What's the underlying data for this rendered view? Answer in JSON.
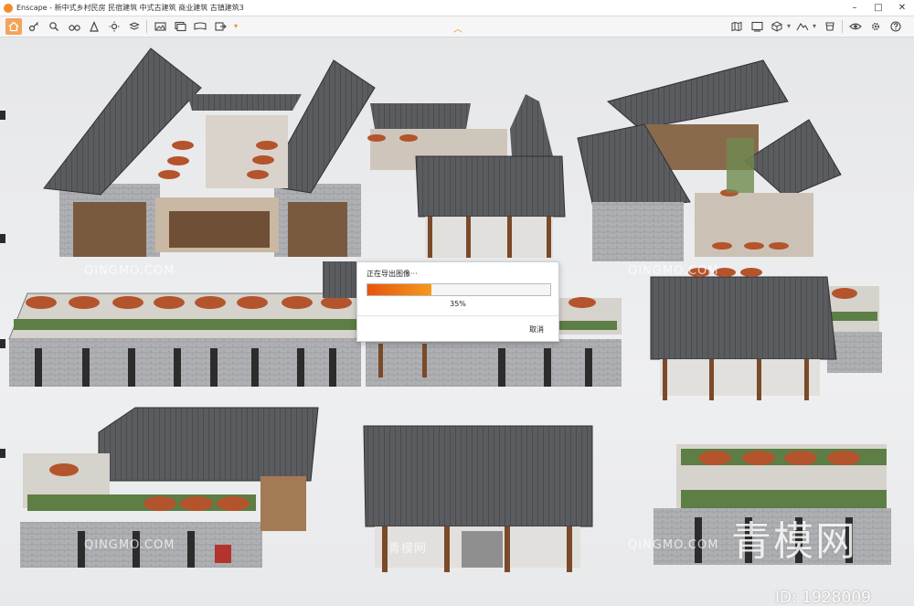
{
  "window": {
    "app_name": "Enscape",
    "title": "Enscape - 新中式乡村民房 民宿建筑 中式古建筑 商业建筑 古镇建筑3",
    "controls": [
      "minimize-icon",
      "maximize-icon",
      "close-icon"
    ]
  },
  "toolbar": {
    "left_tools": [
      "home-icon",
      "key-icon",
      "binoculars-icon",
      "settings-icon",
      "person-icon",
      "layers-icon",
      "ruler-icon",
      "video-icon",
      "panorama-icon",
      "export-icon"
    ],
    "right_tools": [
      "map-icon",
      "screen-icon",
      "cube-icon",
      "mountain-icon",
      "material-icon",
      "cloud-icon",
      "eye-icon",
      "gear-icon",
      "help-icon"
    ],
    "accent_color": "#f3a35b"
  },
  "dialog": {
    "title": "正在导出图像···",
    "progress_percent": 35,
    "progress_label": "35%",
    "cancel_label": "取消",
    "progress_color": "#f0650f"
  },
  "watermarks": {
    "brand": "青模网",
    "id_text": "ID: 1928009",
    "site": "QINGMO.COM",
    "site_cn": "青模网"
  }
}
